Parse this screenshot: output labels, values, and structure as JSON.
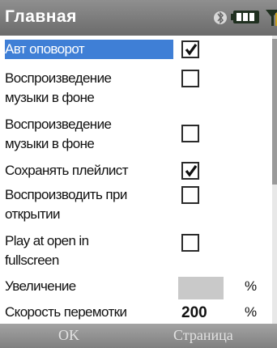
{
  "window": {
    "title": "Главная"
  },
  "status": {
    "icons": [
      "bluetooth-icon",
      "battery-icon",
      "signal-icon"
    ]
  },
  "settings": [
    {
      "label": "Авт оповорот",
      "checked": true,
      "selected": true
    },
    {
      "label_line1": "Воспроизведение",
      "label_line2": "музыки в фоне",
      "checked": false
    },
    {
      "label_line1": "Воспроизведение",
      "label_line2": "музыки в фоне",
      "checked": false
    },
    {
      "label": "Сохранять плейлист",
      "checked": true
    },
    {
      "label_line1": "Воспроизводить при",
      "label_line2": "открытии",
      "checked": false
    },
    {
      "label_line1": "Play at open in",
      "label_line2": "fullscreen",
      "checked": false
    }
  ],
  "zoom": {
    "label": "Увеличение",
    "value": "",
    "unit": "%"
  },
  "rewind": {
    "label": "Скорость перемотки",
    "value": "200",
    "unit": "%"
  },
  "softkeys": {
    "left": "OK",
    "right": "Страница"
  },
  "colors": {
    "selection": "#3f7fd6",
    "titlebar": "#7a7a7a"
  }
}
